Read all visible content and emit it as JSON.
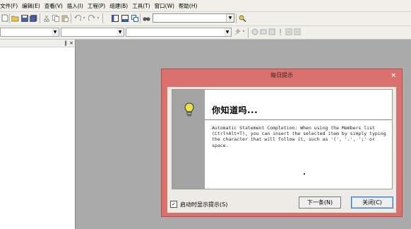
{
  "menu": [
    "文件(F)",
    "编辑(E)",
    "查看(V)",
    "插入(I)",
    "工程(P)",
    "组建(B)",
    "工具(T)",
    "窗口(W)",
    "帮助(H)"
  ],
  "dialog": {
    "title": "每日提示",
    "close": "×",
    "heading": "你知道吗...",
    "body": "Automatic Statement Completion: When using the Members list (Ctrl+Alt+T), you can insert the selected item by simply typing the character that will follow it, such as '(', '.', ';' or space.",
    "checkbox_label": "启动时显示提示(S)",
    "checkbox_mark": "✓",
    "next_button": "下一条(N)",
    "close_button": "关闭(C)"
  },
  "colors": {
    "dialog_border": "#d9726e",
    "workspace": "#abaaaa"
  },
  "icons": [
    "new-icon",
    "open-icon",
    "save-icon",
    "save-all-icon",
    "cut-icon",
    "copy-icon",
    "paste-icon",
    "undo-icon",
    "redo-icon",
    "workspace-icon",
    "output-icon",
    "window-list-icon",
    "find-in-files-icon",
    "find-icon",
    "lightbulb-icon"
  ]
}
